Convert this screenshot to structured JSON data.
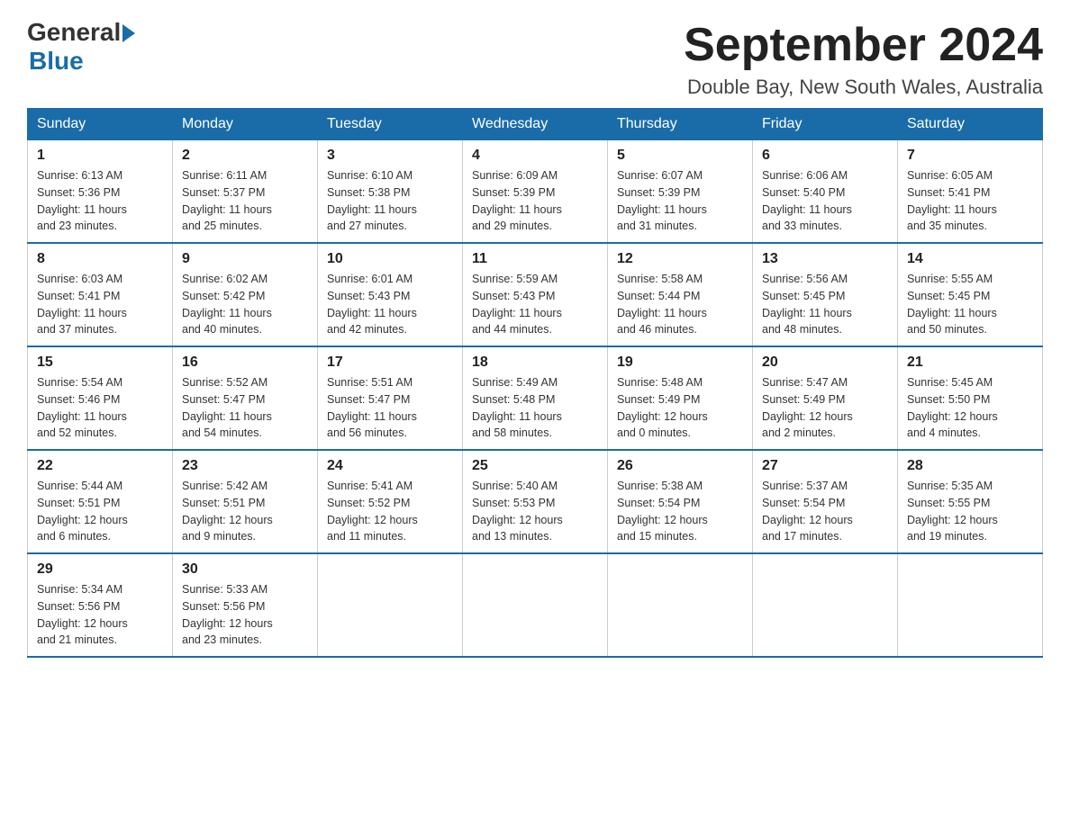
{
  "header": {
    "logo_general": "General",
    "logo_blue": "Blue",
    "month_title": "September 2024",
    "location": "Double Bay, New South Wales, Australia"
  },
  "days_of_week": [
    "Sunday",
    "Monday",
    "Tuesday",
    "Wednesday",
    "Thursday",
    "Friday",
    "Saturday"
  ],
  "weeks": [
    [
      {
        "day": "1",
        "sunrise": "6:13 AM",
        "sunset": "5:36 PM",
        "daylight": "11 hours and 23 minutes."
      },
      {
        "day": "2",
        "sunrise": "6:11 AM",
        "sunset": "5:37 PM",
        "daylight": "11 hours and 25 minutes."
      },
      {
        "day": "3",
        "sunrise": "6:10 AM",
        "sunset": "5:38 PM",
        "daylight": "11 hours and 27 minutes."
      },
      {
        "day": "4",
        "sunrise": "6:09 AM",
        "sunset": "5:39 PM",
        "daylight": "11 hours and 29 minutes."
      },
      {
        "day": "5",
        "sunrise": "6:07 AM",
        "sunset": "5:39 PM",
        "daylight": "11 hours and 31 minutes."
      },
      {
        "day": "6",
        "sunrise": "6:06 AM",
        "sunset": "5:40 PM",
        "daylight": "11 hours and 33 minutes."
      },
      {
        "day": "7",
        "sunrise": "6:05 AM",
        "sunset": "5:41 PM",
        "daylight": "11 hours and 35 minutes."
      }
    ],
    [
      {
        "day": "8",
        "sunrise": "6:03 AM",
        "sunset": "5:41 PM",
        "daylight": "11 hours and 37 minutes."
      },
      {
        "day": "9",
        "sunrise": "6:02 AM",
        "sunset": "5:42 PM",
        "daylight": "11 hours and 40 minutes."
      },
      {
        "day": "10",
        "sunrise": "6:01 AM",
        "sunset": "5:43 PM",
        "daylight": "11 hours and 42 minutes."
      },
      {
        "day": "11",
        "sunrise": "5:59 AM",
        "sunset": "5:43 PM",
        "daylight": "11 hours and 44 minutes."
      },
      {
        "day": "12",
        "sunrise": "5:58 AM",
        "sunset": "5:44 PM",
        "daylight": "11 hours and 46 minutes."
      },
      {
        "day": "13",
        "sunrise": "5:56 AM",
        "sunset": "5:45 PM",
        "daylight": "11 hours and 48 minutes."
      },
      {
        "day": "14",
        "sunrise": "5:55 AM",
        "sunset": "5:45 PM",
        "daylight": "11 hours and 50 minutes."
      }
    ],
    [
      {
        "day": "15",
        "sunrise": "5:54 AM",
        "sunset": "5:46 PM",
        "daylight": "11 hours and 52 minutes."
      },
      {
        "day": "16",
        "sunrise": "5:52 AM",
        "sunset": "5:47 PM",
        "daylight": "11 hours and 54 minutes."
      },
      {
        "day": "17",
        "sunrise": "5:51 AM",
        "sunset": "5:47 PM",
        "daylight": "11 hours and 56 minutes."
      },
      {
        "day": "18",
        "sunrise": "5:49 AM",
        "sunset": "5:48 PM",
        "daylight": "11 hours and 58 minutes."
      },
      {
        "day": "19",
        "sunrise": "5:48 AM",
        "sunset": "5:49 PM",
        "daylight": "12 hours and 0 minutes."
      },
      {
        "day": "20",
        "sunrise": "5:47 AM",
        "sunset": "5:49 PM",
        "daylight": "12 hours and 2 minutes."
      },
      {
        "day": "21",
        "sunrise": "5:45 AM",
        "sunset": "5:50 PM",
        "daylight": "12 hours and 4 minutes."
      }
    ],
    [
      {
        "day": "22",
        "sunrise": "5:44 AM",
        "sunset": "5:51 PM",
        "daylight": "12 hours and 6 minutes."
      },
      {
        "day": "23",
        "sunrise": "5:42 AM",
        "sunset": "5:51 PM",
        "daylight": "12 hours and 9 minutes."
      },
      {
        "day": "24",
        "sunrise": "5:41 AM",
        "sunset": "5:52 PM",
        "daylight": "12 hours and 11 minutes."
      },
      {
        "day": "25",
        "sunrise": "5:40 AM",
        "sunset": "5:53 PM",
        "daylight": "12 hours and 13 minutes."
      },
      {
        "day": "26",
        "sunrise": "5:38 AM",
        "sunset": "5:54 PM",
        "daylight": "12 hours and 15 minutes."
      },
      {
        "day": "27",
        "sunrise": "5:37 AM",
        "sunset": "5:54 PM",
        "daylight": "12 hours and 17 minutes."
      },
      {
        "day": "28",
        "sunrise": "5:35 AM",
        "sunset": "5:55 PM",
        "daylight": "12 hours and 19 minutes."
      }
    ],
    [
      {
        "day": "29",
        "sunrise": "5:34 AM",
        "sunset": "5:56 PM",
        "daylight": "12 hours and 21 minutes."
      },
      {
        "day": "30",
        "sunrise": "5:33 AM",
        "sunset": "5:56 PM",
        "daylight": "12 hours and 23 minutes."
      },
      null,
      null,
      null,
      null,
      null
    ]
  ],
  "labels": {
    "sunrise_prefix": "Sunrise: ",
    "sunset_prefix": "Sunset: ",
    "daylight_prefix": "Daylight: "
  }
}
